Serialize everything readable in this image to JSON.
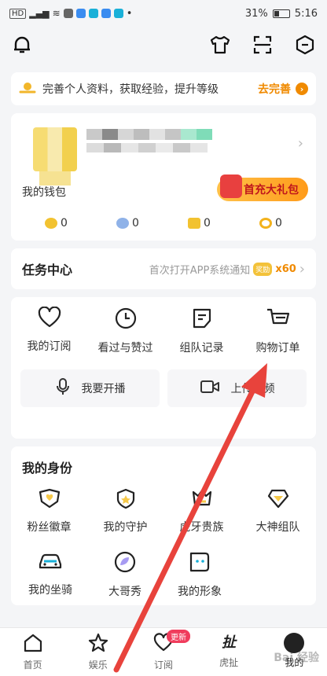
{
  "status_bar": {
    "left_text": "HD",
    "battery": "31%",
    "time": "5:16"
  },
  "banner": {
    "text": "完善个人资料，获取经验，提升等级",
    "action": "去完善"
  },
  "profile": {
    "wallet_label": "我的钱包",
    "gift_label": "首充大礼包",
    "balances": [
      {
        "icon": "gold-bean-icon",
        "color": "#f2c230",
        "value": "0"
      },
      {
        "icon": "silver-bean-icon",
        "color": "#8fb2e8",
        "value": "0"
      },
      {
        "icon": "coupon-icon",
        "color": "#f2c230",
        "value": "0"
      },
      {
        "icon": "coin-icon",
        "color": "#f3b21c",
        "value": "0"
      }
    ]
  },
  "task_center": {
    "title": "任务中心",
    "subtitle": "首次打开APP系统通知",
    "badge": "奖励",
    "reward": "x60"
  },
  "menu": {
    "items": [
      {
        "label": "我的订阅",
        "icon": "heart-icon"
      },
      {
        "label": "看过与赞过",
        "icon": "clock-icon"
      },
      {
        "label": "组队记录",
        "icon": "note-icon"
      },
      {
        "label": "购物订单",
        "icon": "cart-icon"
      }
    ],
    "buttons": [
      {
        "label": "我要开播",
        "icon": "microphone-icon"
      },
      {
        "label": "上传视频",
        "icon": "video-camera-icon"
      }
    ]
  },
  "identity": {
    "title": "我的身份",
    "row1": [
      {
        "label": "粉丝徽章",
        "icon": "fan-badge-icon"
      },
      {
        "label": "我的守护",
        "icon": "guardian-icon"
      },
      {
        "label": "虎牙贵族",
        "icon": "noble-icon"
      },
      {
        "label": "大神组队",
        "icon": "master-team-icon"
      }
    ],
    "row2": [
      {
        "label": "我的坐骑",
        "icon": "mount-car-icon"
      },
      {
        "label": "大哥秀",
        "icon": "show-icon"
      },
      {
        "label": "我的形象",
        "icon": "avatar-image-icon"
      }
    ]
  },
  "tabbar": {
    "items": [
      {
        "label": "首页",
        "icon": "home-icon"
      },
      {
        "label": "娱乐",
        "icon": "star-icon"
      },
      {
        "label": "订阅",
        "icon": "heart-icon",
        "badge": "更新"
      },
      {
        "label": "虎扯",
        "icon": "huche-icon"
      },
      {
        "label": "我的",
        "icon": "me-icon"
      }
    ]
  },
  "watermark": "Bai 经验"
}
